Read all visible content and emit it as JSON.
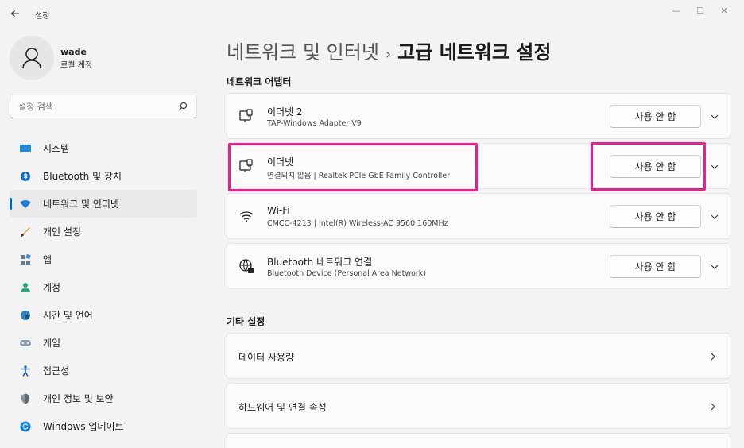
{
  "window": {
    "title": "설정",
    "minimize": "—",
    "maximize": "☐",
    "close": "✕"
  },
  "user": {
    "name": "wade",
    "account_type": "로컬 계정"
  },
  "search": {
    "placeholder": "설정 검색"
  },
  "nav": [
    {
      "label": "시스템",
      "icon": "system-icon"
    },
    {
      "label": "Bluetooth 및 장치",
      "icon": "bluetooth-icon"
    },
    {
      "label": "네트워크 및 인터넷",
      "icon": "network-icon",
      "active": true
    },
    {
      "label": "개인 설정",
      "icon": "brush-icon"
    },
    {
      "label": "앱",
      "icon": "apps-icon"
    },
    {
      "label": "계정",
      "icon": "account-icon"
    },
    {
      "label": "시간 및 언어",
      "icon": "globe-clock-icon"
    },
    {
      "label": "게임",
      "icon": "gamepad-icon"
    },
    {
      "label": "접근성",
      "icon": "accessibility-icon"
    },
    {
      "label": "개인 정보 및 보안",
      "icon": "shield-icon"
    },
    {
      "label": "Windows 업데이트",
      "icon": "update-icon"
    }
  ],
  "header": {
    "breadcrumb_parent": "네트워크 및 인터넷",
    "separator": "›",
    "current": "고급 네트워크 설정"
  },
  "adapters": {
    "section_title": "네트워크 어댑터",
    "items": [
      {
        "name": "이더넷 2",
        "description": "TAP-Windows Adapter V9",
        "button": "사용 안 함",
        "icon": "ethernet-icon"
      },
      {
        "name": "이더넷",
        "description": "연결되지 않음 | Realtek PCIe GbE Family Controller",
        "button": "사용 안 함",
        "icon": "ethernet-icon"
      },
      {
        "name": "Wi-Fi",
        "description": "CMCC-4213 | Intel(R) Wireless-AC 9560 160MHz",
        "button": "사용 안 함",
        "icon": "wifi-icon"
      },
      {
        "name": "Bluetooth 네트워크 연결",
        "description": "Bluetooth Device (Personal Area Network)",
        "button": "사용 안 함",
        "icon": "bluetooth-network-icon"
      }
    ]
  },
  "other": {
    "section_title": "기타 설정",
    "items": [
      {
        "label": "데이터 사용량"
      },
      {
        "label": "하드웨어 및 연결 속성"
      }
    ]
  },
  "colors": {
    "accent": "#0067c0",
    "highlight": "#ef1d8c"
  }
}
